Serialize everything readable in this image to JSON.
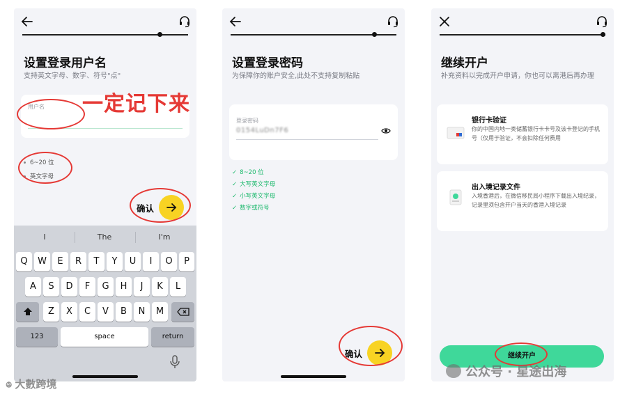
{
  "screen1": {
    "title": "设置登录用户名",
    "subtitle": "支持英文字母、数字、符号\"点\"",
    "field_label": "用户名",
    "rules": [
      "6~20 位",
      "英文字母"
    ],
    "confirm_label": "确认",
    "annotation": "一定记下来",
    "suggestions": [
      "I",
      "The",
      "I'm"
    ],
    "keyboard": {
      "row1": [
        "Q",
        "W",
        "E",
        "R",
        "T",
        "Y",
        "U",
        "I",
        "O",
        "P"
      ],
      "row2": [
        "A",
        "S",
        "D",
        "F",
        "G",
        "H",
        "J",
        "K",
        "L"
      ],
      "row3": [
        "Z",
        "X",
        "C",
        "V",
        "B",
        "N",
        "M"
      ],
      "numbers_label": "123",
      "space_label": "space",
      "return_label": "return"
    }
  },
  "screen2": {
    "title": "设置登录密码",
    "subtitle": "为保障你的账户安全,此处不支持复制粘贴",
    "field_label": "登录密码",
    "password_value": "0154LuDn7F6",
    "rules": [
      "8~20 位",
      "大写英文字母",
      "小写英文字母",
      "数字或符号"
    ],
    "confirm_label": "确认"
  },
  "screen3": {
    "title": "继续开户",
    "subtitle": "补充资料以完成开户申请，你也可以离港后再办理",
    "cards": [
      {
        "title": "银行卡验证",
        "desc": "你的中国内地一类储蓄银行卡卡号及该卡登记的手机号（仅用于验证，不会扣除任何费用"
      },
      {
        "title": "出入境记录文件",
        "desc": "入境香港后，在微信移民局小程序下载出入境纪录，记录里须包含开户当天的香港入境记录"
      }
    ],
    "continue_label": "继续开户"
  },
  "watermarks": {
    "left": "大數跨境",
    "right": "公众号 · 星途出海"
  },
  "colors": {
    "accent_yellow": "#f8d323",
    "accent_green": "#3fd89a",
    "rule_green": "#1db96d",
    "annotation_red": "#e53935"
  }
}
